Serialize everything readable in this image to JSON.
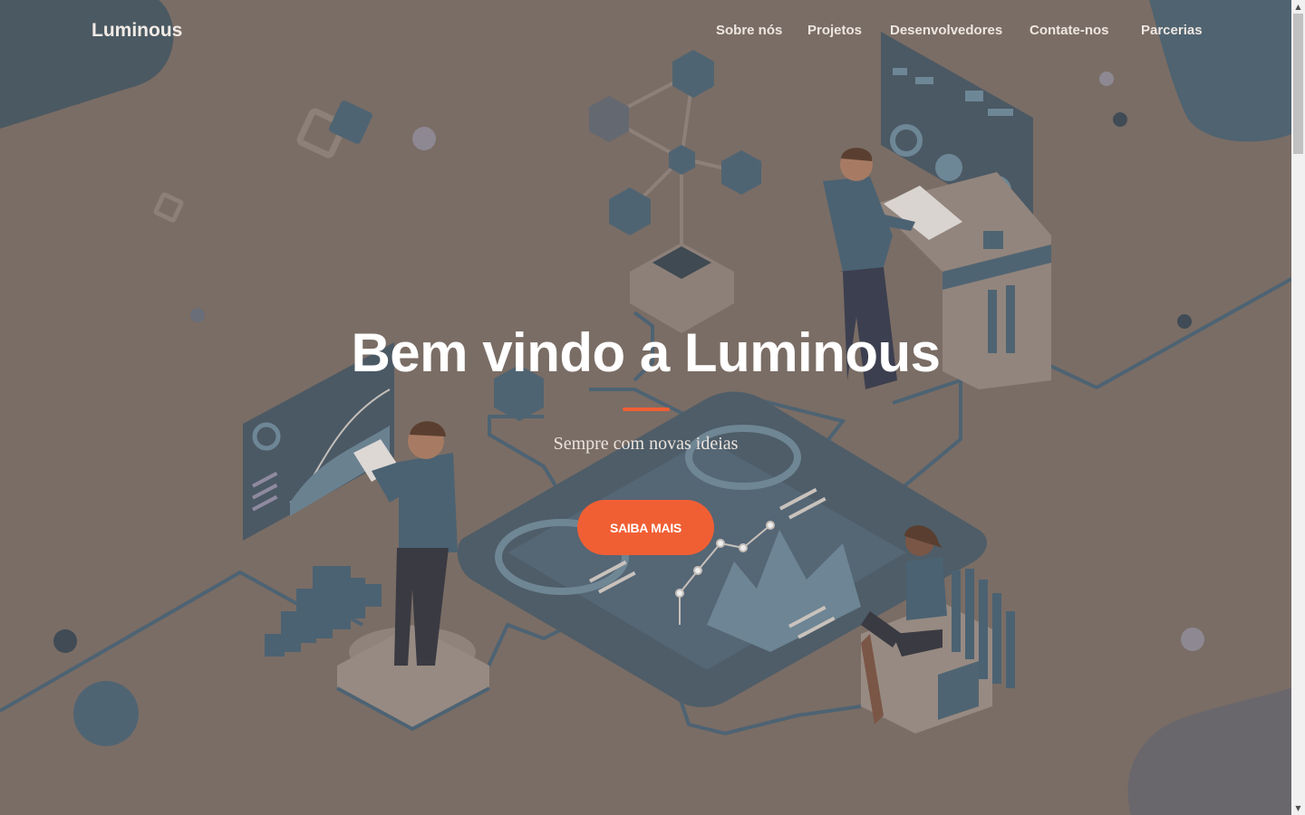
{
  "navbar": {
    "brand": "Luminous",
    "links": [
      "Sobre nós",
      "Projetos",
      "Desenvolvedores",
      "Contate-nos",
      "Parcerias"
    ]
  },
  "hero": {
    "title": "Bem vindo a Luminous",
    "subtitle": "Sempre com novas ideias",
    "cta_label": "SAIBA MAIS"
  },
  "icons": {
    "scroll_up": "▲",
    "scroll_down": "▼"
  },
  "colors": {
    "overlay": "#7a6d65",
    "accent": "#f05f34",
    "illustration_blue": "#4a5f6e",
    "text": "#ffffff"
  }
}
